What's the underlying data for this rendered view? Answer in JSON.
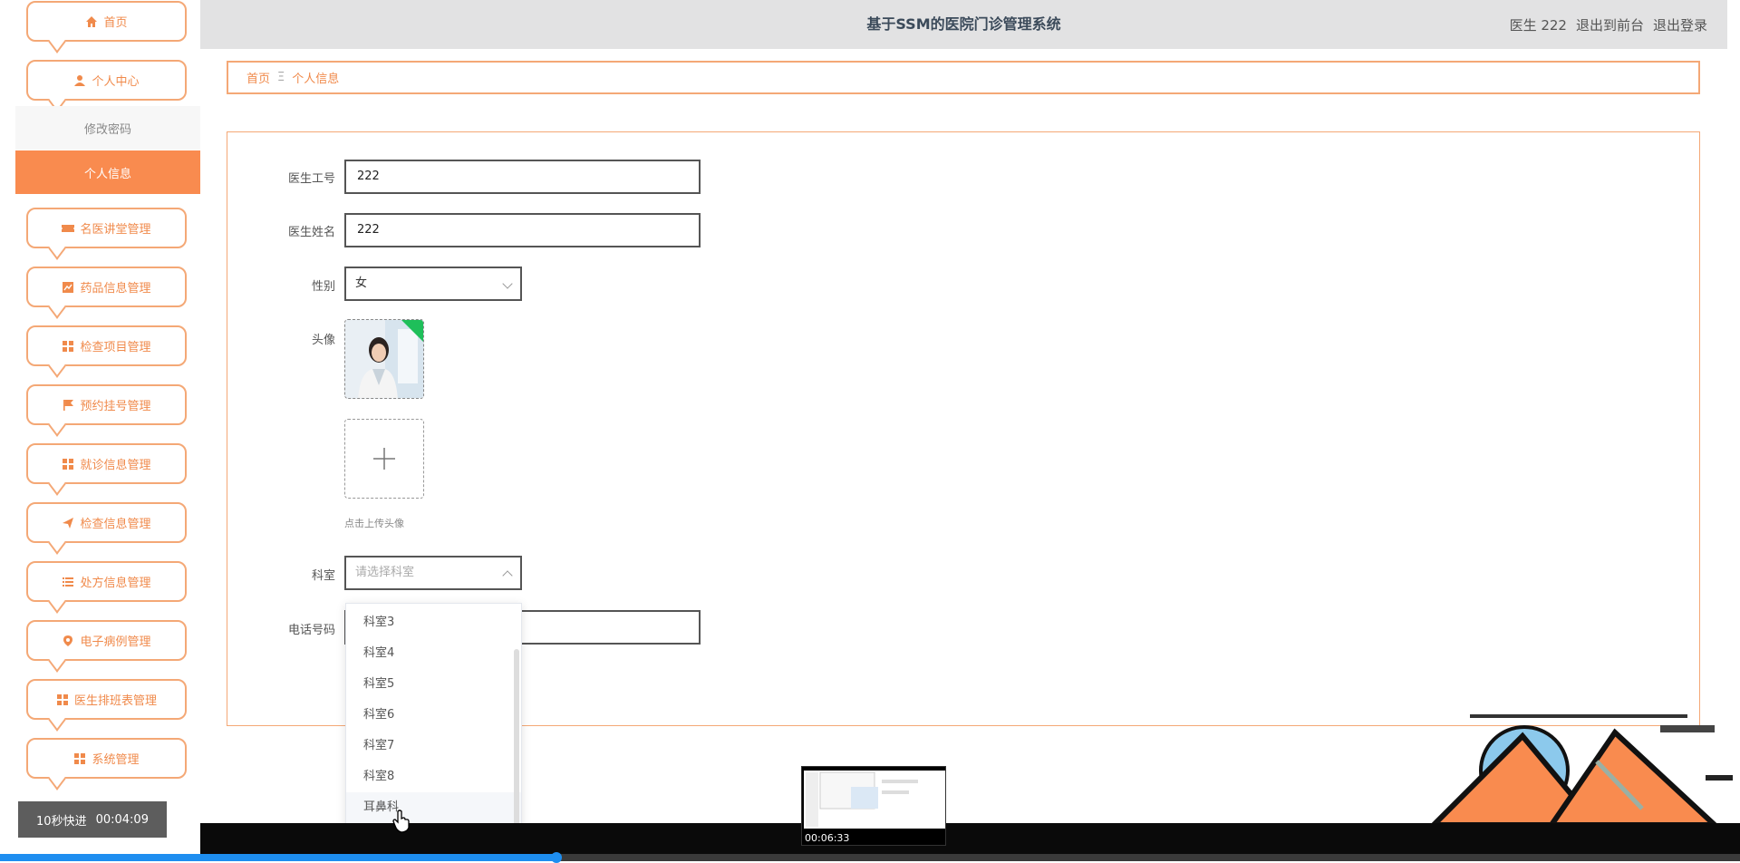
{
  "app": {
    "title": "基于SSM的医院门诊管理系统",
    "user_label": "医生 222",
    "link_front": "退出到前台",
    "link_logout": "退出登录"
  },
  "sidebar": {
    "home": "首页",
    "personal_center": "个人中心",
    "change_password": "修改密码",
    "personal_info": "个人信息",
    "items": [
      {
        "label": "名医讲堂管理",
        "icon": "ticket-icon"
      },
      {
        "label": "药品信息管理",
        "icon": "chart-icon"
      },
      {
        "label": "检查项目管理",
        "icon": "grid-icon"
      },
      {
        "label": "预约挂号管理",
        "icon": "flag-icon"
      },
      {
        "label": "就诊信息管理",
        "icon": "grid-icon"
      },
      {
        "label": "检查信息管理",
        "icon": "send-icon"
      },
      {
        "label": "处方信息管理",
        "icon": "list-icon"
      },
      {
        "label": "电子病例管理",
        "icon": "location-icon"
      },
      {
        "label": "医生排班表管理",
        "icon": "grid-icon"
      },
      {
        "label": "系统管理",
        "icon": "grid-icon"
      }
    ]
  },
  "breadcrumb": {
    "home": "首页",
    "separator": "Ξ",
    "current": "个人信息"
  },
  "form": {
    "doctor_id_label": "医生工号",
    "doctor_id_value": "222",
    "doctor_name_label": "医生姓名",
    "doctor_name_value": "222",
    "gender_label": "性别",
    "gender_value": "女",
    "avatar_label": "头像",
    "upload_tip": "点击上传头像",
    "department_label": "科室",
    "department_placeholder": "请选择科室",
    "phone_label": "电话号码",
    "phone_value": ""
  },
  "dropdown": {
    "options": [
      "科室3",
      "科室4",
      "科室5",
      "科室6",
      "科室7",
      "科室8",
      "耳鼻科"
    ],
    "hovered": "耳鼻科"
  },
  "player": {
    "speed_label": "10秒快进",
    "speed_time": "00:04:09",
    "thumb_time": "00:06:33",
    "progress": 0.32
  },
  "colors": {
    "accent": "#f98b4f",
    "accent_border": "#f4a876",
    "topbar": "#e2e2e3",
    "progress": "#1e8ef0"
  }
}
